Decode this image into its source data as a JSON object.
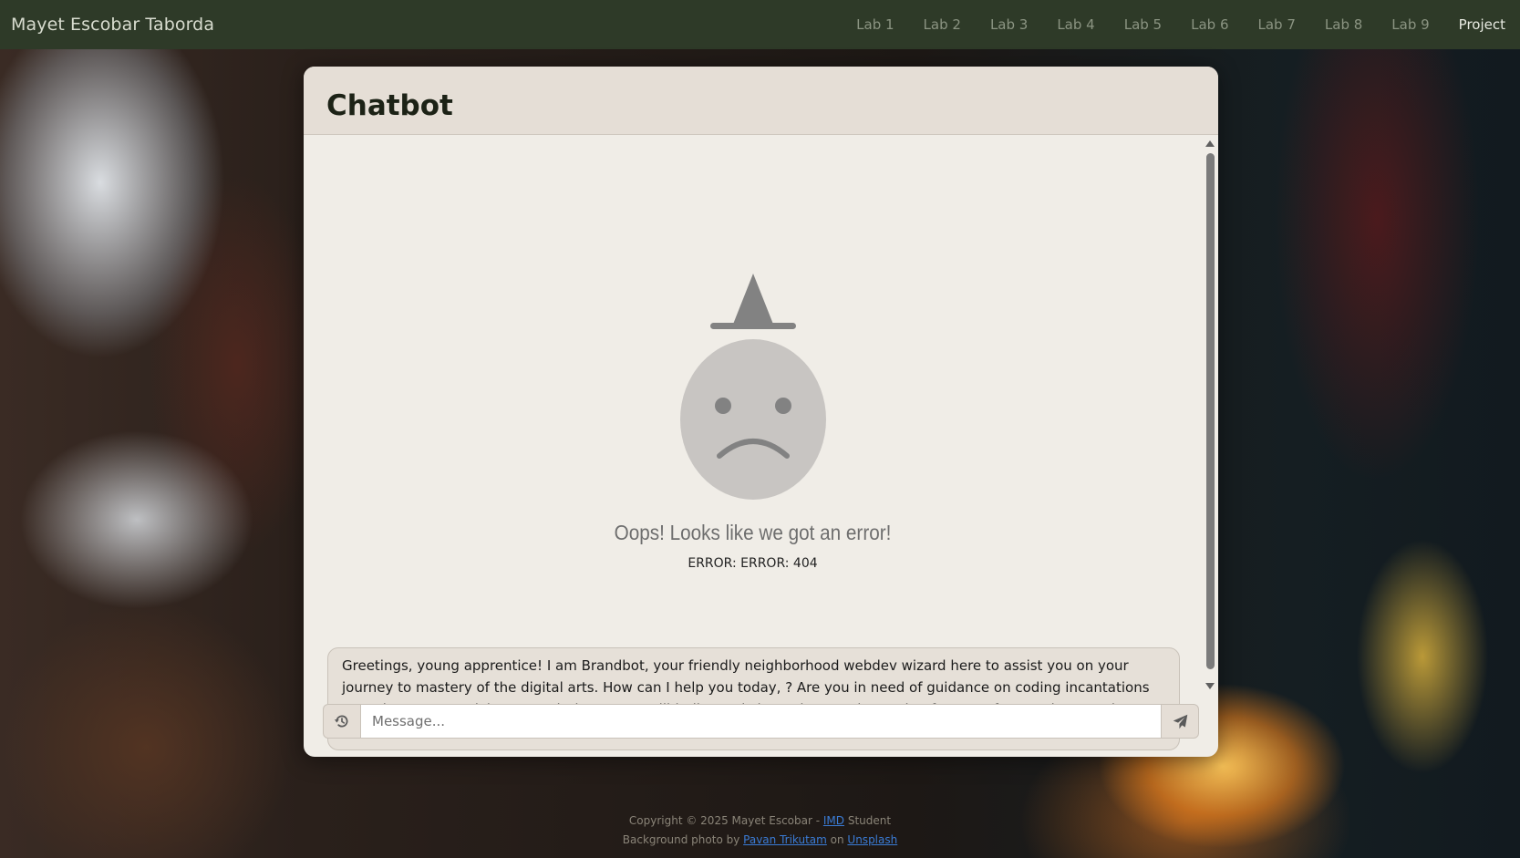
{
  "navbar": {
    "brand": "Mayet Escobar Taborda",
    "links": [
      {
        "label": "Lab 1"
      },
      {
        "label": "Lab 2"
      },
      {
        "label": "Lab 3"
      },
      {
        "label": "Lab 4"
      },
      {
        "label": "Lab 5"
      },
      {
        "label": "Lab 6"
      },
      {
        "label": "Lab 7"
      },
      {
        "label": "Lab 8"
      },
      {
        "label": "Lab 9"
      },
      {
        "label": "Project"
      }
    ]
  },
  "chatbot": {
    "title": "Chatbot",
    "error": {
      "title": "Oops! Looks like we got an error!",
      "code": "ERROR: ERROR: 404"
    },
    "bot_message": "Greetings, young apprentice! I am Brandbot, your friendly neighborhood webdev wizard here to assist you on your journey to mastery of the digital arts. How can I help you today, ? Are you in need of guidance on coding incantations or perhaps some advice on conjuring up a spellbinding website? Whatever it may be, fear not, for I am here to share my knowledge and magic with you. Let's embark on this adventure together, shall we?",
    "input": {
      "placeholder": "Message...",
      "value": ""
    },
    "icons": {
      "history": "history-icon",
      "send": "paper-plane-icon"
    }
  },
  "footer": {
    "line1_prefix": "Copyright © 2025 Mayet Escobar - ",
    "line1_link": "IMD",
    "line1_suffix": " Student",
    "line2_prefix": "Background photo by ",
    "line2_link1": "Pavan Trikutam",
    "line2_mid": " on ",
    "line2_link2": "Unsplash"
  },
  "colors": {
    "navbar_bg": "#2e3a28",
    "card_bg": "#f0ede7",
    "header_bg": "#e5ded6",
    "link": "#3a7bd5"
  }
}
